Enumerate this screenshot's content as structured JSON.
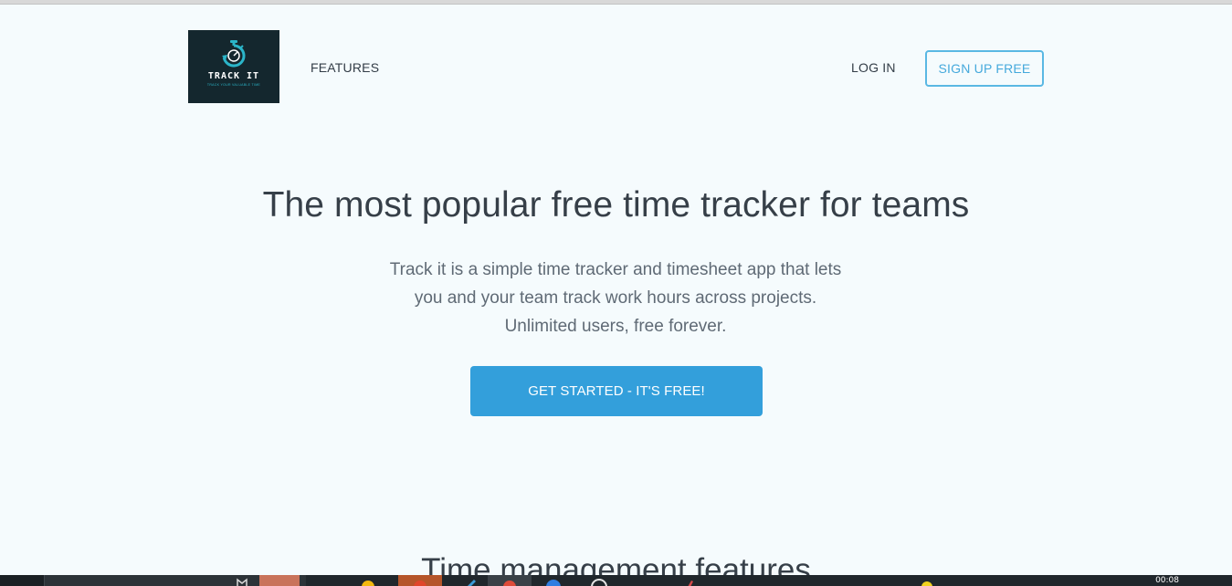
{
  "header": {
    "logo": {
      "title": "TRACK IT",
      "tagline": "TRACK YOUR VALUABLE TIME",
      "icon": "stopwatch-icon",
      "bg_color": "#14272e",
      "accent_color": "#2bb5c9"
    },
    "nav": {
      "features_label": "FEATURES",
      "login_label": "LOG IN",
      "signup_label": "SIGN UP FREE"
    }
  },
  "hero": {
    "title": "The most popular free time tracker for teams",
    "description_lines": [
      "Track it is a simple time tracker and timesheet app that lets",
      "you and your team track work hours across projects.",
      "Unlimited users, free forever."
    ],
    "cta_label": "GET STARTED - IT'S FREE!",
    "cta_color": "#339fdb"
  },
  "features_section": {
    "heading": "Time management features"
  },
  "taskbar": {
    "clock": "00:08"
  },
  "colors": {
    "page_bg": "#f5fbfd",
    "text_dark": "#363f48",
    "text_muted": "#5f6a75",
    "accent_blue": "#45a9dc"
  }
}
